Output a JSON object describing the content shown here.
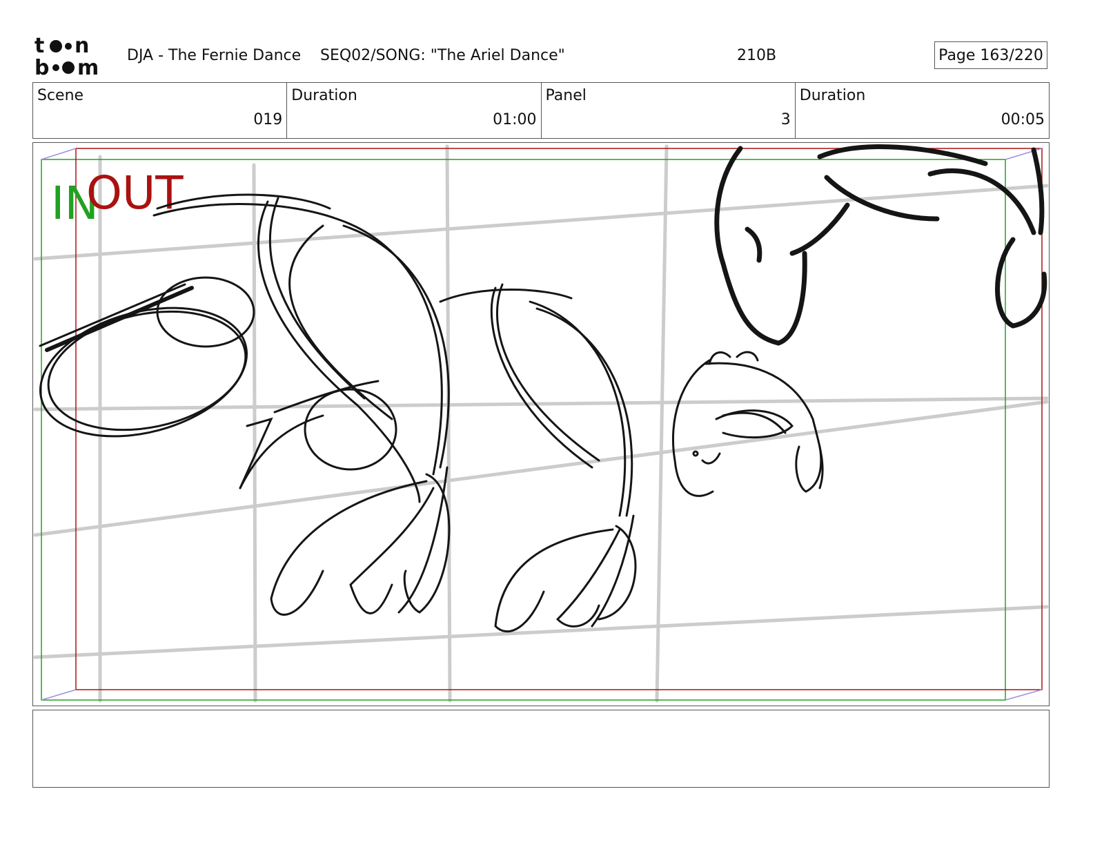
{
  "header": {
    "project_title": "DJA - The Fernie Dance",
    "sequence": "SEQ02/SONG: \"The Ariel Dance\"",
    "shot_code": "210B",
    "page": "Page 163/220"
  },
  "logo": {
    "name": "toon boom",
    "line1": "toon",
    "line2": "boom"
  },
  "info": {
    "scene_label": "Scene",
    "scene_value": "019",
    "scene_duration_label": "Duration",
    "scene_duration_value": "01:00",
    "panel_label": "Panel",
    "panel_value": "3",
    "panel_duration_label": "Duration",
    "panel_duration_value": "00:05"
  },
  "panel": {
    "in_label": "IN",
    "out_label": "OUT",
    "colors": {
      "in": "#22a022",
      "out": "#aa1111",
      "grid": "#cccccc",
      "sketch": "#151515",
      "arrow": "#9d8fe0"
    }
  },
  "notes": {
    "text": ""
  }
}
